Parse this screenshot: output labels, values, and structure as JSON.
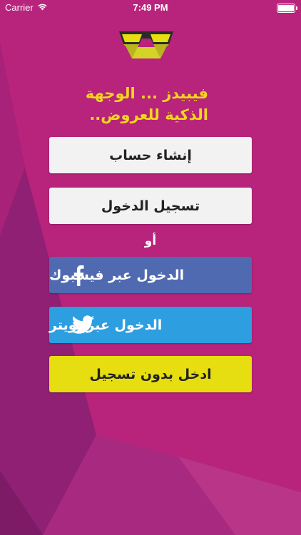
{
  "status_bar": {
    "carrier": "Carrier",
    "time": "7:49 PM"
  },
  "tagline": {
    "line1": "فيبيدز ... الوجهة",
    "line2": "الذكية للعروض.."
  },
  "buttons": {
    "create_account": "إنشاء حساب",
    "login": "تسجيل الدخول",
    "or": "أو",
    "facebook": "الدخول عبر فيسبوك",
    "twitter": "الدخول عبر تويتر",
    "guest": "ادخل بدون تسجيل"
  },
  "colors": {
    "background": "#b8237c",
    "accent_yellow": "#f3d61d",
    "facebook": "#4f6ab0",
    "twitter": "#2d9ee0",
    "guest": "#e6de10"
  },
  "icons": [
    "wifi-icon",
    "battery-icon",
    "logo-glasses-icon",
    "facebook-icon",
    "twitter-icon"
  ]
}
